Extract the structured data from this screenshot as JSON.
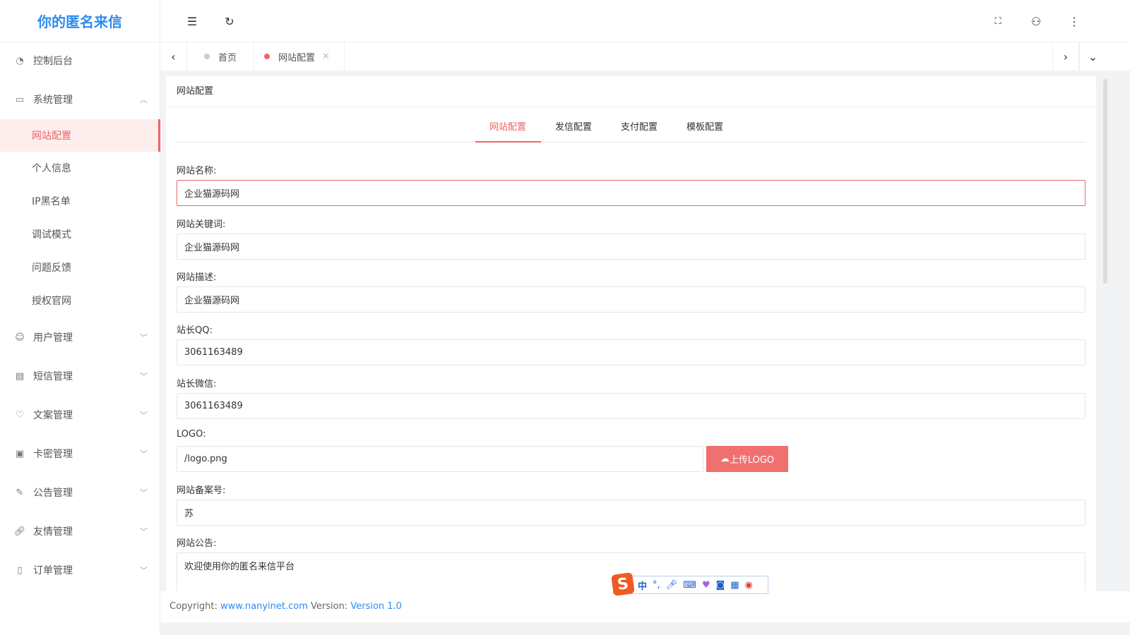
{
  "sidebar": {
    "logo": "你的匿名来信",
    "items": [
      {
        "label": "控制后台",
        "icon": "dashboard-icon"
      },
      {
        "label": "系统管理",
        "icon": "monitor-icon"
      },
      {
        "label": "网站配置"
      },
      {
        "label": "个人信息"
      },
      {
        "label": "IP黑名单"
      },
      {
        "label": "调试模式"
      },
      {
        "label": "问题反馈"
      },
      {
        "label": "授权官网"
      },
      {
        "label": "用户管理",
        "icon": "user-icon"
      },
      {
        "label": "短信管理",
        "icon": "message-icon"
      },
      {
        "label": "文案管理",
        "icon": "heart-icon"
      },
      {
        "label": "卡密管理",
        "icon": "card-icon"
      },
      {
        "label": "公告管理",
        "icon": "edit-icon"
      },
      {
        "label": "友情管理",
        "icon": "link-icon"
      },
      {
        "label": "订单管理",
        "icon": "order-icon"
      }
    ]
  },
  "tabs": [
    {
      "label": "首页"
    },
    {
      "label": "网站配置"
    }
  ],
  "card": {
    "title": "网站配置",
    "tabs": [
      "网站配置",
      "发信配置",
      "支付配置",
      "模板配置"
    ]
  },
  "form": [
    {
      "label": "网站名称:",
      "value": "企业猫源码网"
    },
    {
      "label": "网站关键词:",
      "value": "企业猫源码网"
    },
    {
      "label": "网站描述:",
      "value": "企业猫源码网"
    },
    {
      "label": "站长QQ:",
      "value": "3061163489"
    },
    {
      "label": "站长微信:",
      "value": "3061163489"
    },
    {
      "label": "LOGO:",
      "value": "/logo.png"
    },
    {
      "label": "网站备案号:",
      "value": "苏"
    },
    {
      "label": "网站公告:",
      "value": "欢迎使用你的匿名来信平台"
    }
  ],
  "upload_label": "上传LOGO",
  "footer": {
    "copyright": "Copyright:",
    "site": "www.nanyinet.com",
    "version_label": " Version:",
    "version": "Version 1.0"
  },
  "ime": {
    "label": "中",
    "punct": "°,"
  },
  "colors": {
    "accent": "#ee6666",
    "brand": "#2d8cf0"
  }
}
